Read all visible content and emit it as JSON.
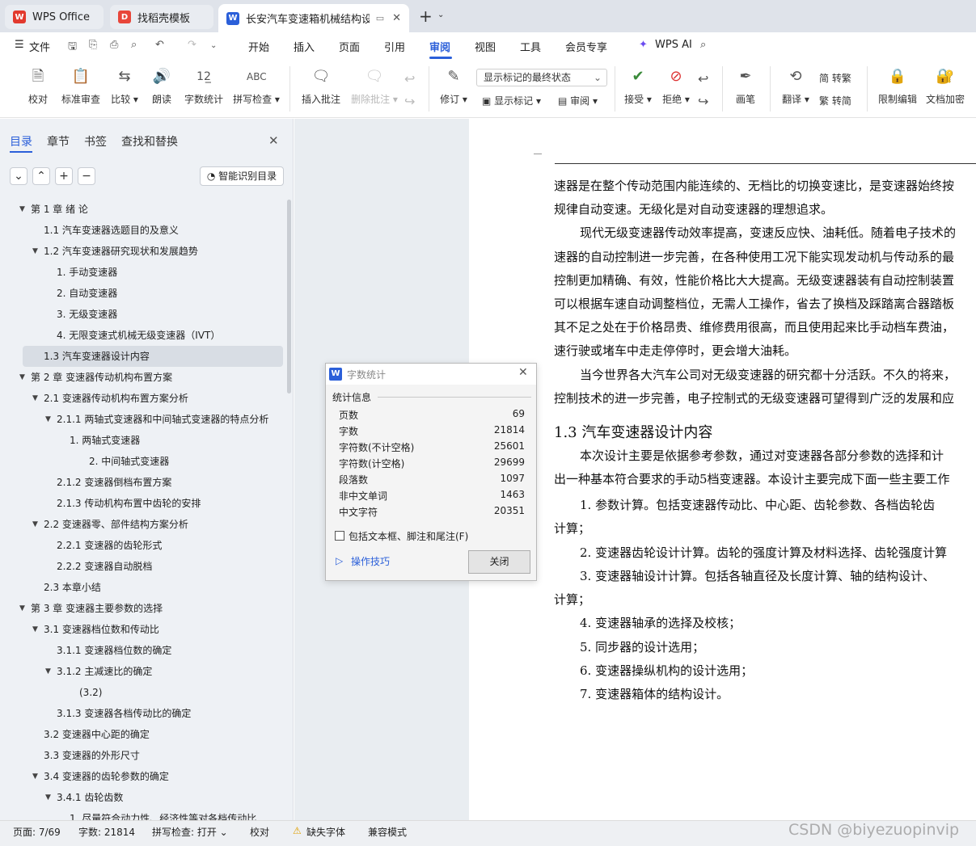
{
  "tabs": [
    {
      "label": "WPS Office",
      "icon": "wps-logo-icon"
    },
    {
      "label": "找稻壳模板",
      "icon": "docer-icon"
    },
    {
      "label": "长安汽车变速箱机械结构设计",
      "icon": "writer-icon"
    }
  ],
  "menu": {
    "file": "文件",
    "items": [
      "开始",
      "插入",
      "页面",
      "引用",
      "审阅",
      "视图",
      "工具",
      "会员专享"
    ],
    "active": "审阅",
    "ai": "WPS AI"
  },
  "ribbon": {
    "proofread": "校对",
    "std_review": "标准审查",
    "compare": "比较",
    "read_aloud": "朗读",
    "word_count": "字数统计",
    "spell_check": "拼写检查",
    "insert_comment": "插入批注",
    "delete_comment": "删除批注",
    "revise": "修订",
    "markup_state": "显示标记的最终状态",
    "show_markup": "显示标记",
    "review_pane": "审阅",
    "accept": "接受",
    "reject": "拒绝",
    "pen": "画笔",
    "translate": "翻译",
    "to_trad": "简 转繁",
    "to_simp": "繁 转简",
    "restrict": "限制编辑",
    "encrypt": "文档加密"
  },
  "nav": {
    "tabs": [
      "目录",
      "章节",
      "书签",
      "查找和替换"
    ],
    "smart_toc": "智能识别目录",
    "items": [
      {
        "text": "第 1 章  绪      论",
        "level": 0,
        "arrow": true
      },
      {
        "text": "1.1 汽车变速器选题目的及意义",
        "level": 1,
        "arrow": false
      },
      {
        "text": "1.2 汽车变速器研究现状和发展趋势",
        "level": 1,
        "arrow": true
      },
      {
        "text": "1.  手动变速器",
        "level": 2,
        "arrow": false
      },
      {
        "text": "2.  自动变速器",
        "level": 2,
        "arrow": false
      },
      {
        "text": "3.  无级变速器",
        "level": 2,
        "arrow": false
      },
      {
        "text": "4.  无限变速式机械无级变速器（IVT）",
        "level": 2,
        "arrow": false
      },
      {
        "text": "1.3 汽车变速器设计内容",
        "level": 1,
        "arrow": false,
        "selected": true
      },
      {
        "text": "第 2 章  变速器传动机构布置方案",
        "level": 0,
        "arrow": true
      },
      {
        "text": "2.1 变速器传动机构布置方案分析",
        "level": 1,
        "arrow": true
      },
      {
        "text": "2.1.1 两轴式变速器和中间轴式变速器的特点分析",
        "level": 2,
        "arrow": true
      },
      {
        "text": "1.  两轴式变速器",
        "level": 3,
        "arrow": false
      },
      {
        "text": "2.  中间轴式变速器",
        "level": 4,
        "arrow": false
      },
      {
        "text": "2.1.2 变速器倒档布置方案",
        "level": 2,
        "arrow": false
      },
      {
        "text": "2.1.3 传动机构布置中齿轮的安排",
        "level": 2,
        "arrow": false
      },
      {
        "text": "2.2 变速器零、部件结构方案分析",
        "level": 1,
        "arrow": true
      },
      {
        "text": "2.2.1 变速器的齿轮形式",
        "level": 2,
        "arrow": false
      },
      {
        "text": "2.2.2 变速器自动脱档",
        "level": 2,
        "arrow": false
      },
      {
        "text": "2.3 本章小结",
        "level": 1,
        "arrow": false
      },
      {
        "text": "第 3 章  变速器主要参数的选择",
        "level": 0,
        "arrow": true
      },
      {
        "text": "3.1 变速器档位数和传动比",
        "level": 1,
        "arrow": true
      },
      {
        "text": "3.1.1 变速器档位数的确定",
        "level": 2,
        "arrow": false
      },
      {
        "text": "3.1.2 主减速比的确定",
        "level": 2,
        "arrow": true
      },
      {
        "text": "(3.2)",
        "level": 5,
        "arrow": false
      },
      {
        "text": "3.1.3  变速器各档传动比的确定",
        "level": 2,
        "arrow": false
      },
      {
        "text": "3.2 变速器中心距的确定",
        "level": 1,
        "arrow": false
      },
      {
        "text": "3.3 变速器的外形尺寸",
        "level": 1,
        "arrow": false
      },
      {
        "text": "3.4 变速器的齿轮参数的确定",
        "level": 1,
        "arrow": true
      },
      {
        "text": "3.4.1 齿轮齿数",
        "level": 2,
        "arrow": true
      },
      {
        "text": "1.  尽量符合动力性、经济性等对各档传动比",
        "level": 3,
        "arrow": false
      }
    ]
  },
  "doc": {
    "lines": [
      "速器是在整个传动范围内能连续的、无档比的切换变速比，是变速器始终按",
      "规律自动变速。无级化是对自动变速器的理想追求。",
      "现代无级变速器传动效率提高，变速反应快、油耗低。随着电子技术的",
      "速器的自动控制进一步完善，在各种使用工况下能实现发动机与传动系的最",
      "控制更加精确、有效，性能价格比大大提高。无级变速器装有自动控制装置",
      "可以根据车速自动调整档位，无需人工操作，省去了换档及踩踏离合器踏板",
      "其不足之处在于价格昂贵、维修费用很高，而且使用起来比手动档车费油，",
      "速行驶或堵车中走走停停时，更会增大油耗。",
      "当今世界各大汽车公司对无级变速器的研究都十分活跃。不久的将来，",
      "控制技术的进一步完善，电子控制式的无级变速器可望得到广泛的发展和应"
    ],
    "heading": "1.3 汽车变速器设计内容",
    "lines2": [
      "本次设计主要是依据参考参数，通过对变速器各部分参数的选择和计",
      "出一种基本符合要求的手动5档变速器。本设计主要完成下面一些主要工作",
      "1.   参数计算。包括变速器传动比、中心距、齿轮参数、各档齿轮齿",
      "计算；",
      "2.   变速器齿轮设计计算。齿轮的强度计算及材料选择、齿轮强度计算",
      "3.   变速器轴设计计算。包括各轴直径及长度计算、轴的结构设计、",
      "计算；",
      "4.   变速器轴承的选择及校核；",
      "5.   同步器的设计选用；",
      "6.   变速器操纵机构的设计选用；",
      "7.   变速器箱体的结构设计。"
    ]
  },
  "dialog": {
    "title": "字数统计",
    "group": "统计信息",
    "stats": [
      {
        "label": "页数",
        "value": "69"
      },
      {
        "label": "字数",
        "value": "21814"
      },
      {
        "label": "字符数(不计空格)",
        "value": "25601"
      },
      {
        "label": "字符数(计空格)",
        "value": "29699"
      },
      {
        "label": "段落数",
        "value": "1097"
      },
      {
        "label": "非中文单词",
        "value": "1463"
      },
      {
        "label": "中文字符",
        "value": "20351"
      }
    ],
    "checkbox": "包括文本框、脚注和尾注(F)",
    "tips": "操作技巧",
    "close": "关闭"
  },
  "status": {
    "page": "页面: 7/69",
    "words": "字数: 21814",
    "spell": "拼写检查: 打开",
    "proof": "校对",
    "missing_font": "缺失字体",
    "compat": "兼容模式"
  },
  "watermark": "CSDN @biyezuopinvip"
}
